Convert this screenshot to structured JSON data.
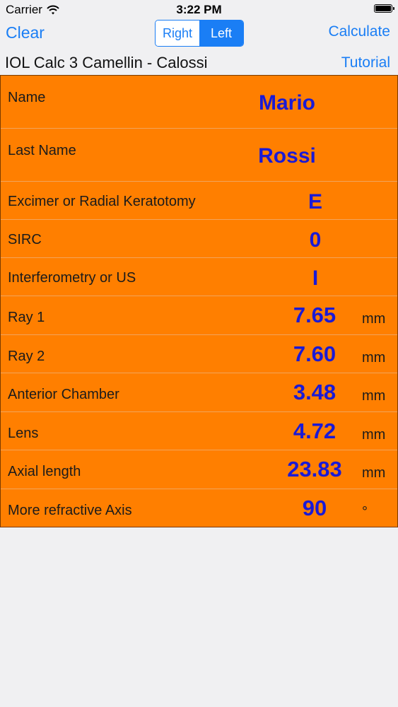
{
  "status_bar": {
    "carrier": "Carrier",
    "time": "3:22 PM"
  },
  "nav": {
    "clear_label": "Clear",
    "segments": [
      "Right",
      "Left"
    ],
    "selected_segment": "Left",
    "calculate_label": "Calculate"
  },
  "title_bar": {
    "app_title": "IOL Calc 3 Camellin - Calossi",
    "tutorial_label": "Tutorial"
  },
  "fields": {
    "name": {
      "label": "Name",
      "value": "Mario"
    },
    "last_name": {
      "label": "Last Name",
      "value": "Rossi"
    },
    "excimer": {
      "label": "Excimer or Radial Keratotomy",
      "value": "E"
    },
    "sirc": {
      "label": "SIRC",
      "value": "0"
    },
    "interferometry": {
      "label": "Interferometry or US",
      "value": "I"
    },
    "ray1": {
      "label": "Ray 1",
      "value": "7.65",
      "unit": "mm"
    },
    "ray2": {
      "label": "Ray 2",
      "value": "7.60",
      "unit": "mm"
    },
    "anterior_chamber": {
      "label": "Anterior Chamber",
      "value": "3.48",
      "unit": "mm"
    },
    "lens": {
      "label": "Lens",
      "value": "4.72",
      "unit": "mm"
    },
    "axial_length": {
      "label": "Axial length",
      "value": "23.83",
      "unit": "mm"
    },
    "refractive_axis": {
      "label": "More refractive Axis",
      "value": "90",
      "unit": "°"
    }
  },
  "colors": {
    "accent": "#1a7ef5",
    "table_background": "#ff7f00",
    "value_text": "#1a1ad6"
  },
  "icons": {
    "wifi": "wifi-icon",
    "battery": "battery-icon"
  }
}
